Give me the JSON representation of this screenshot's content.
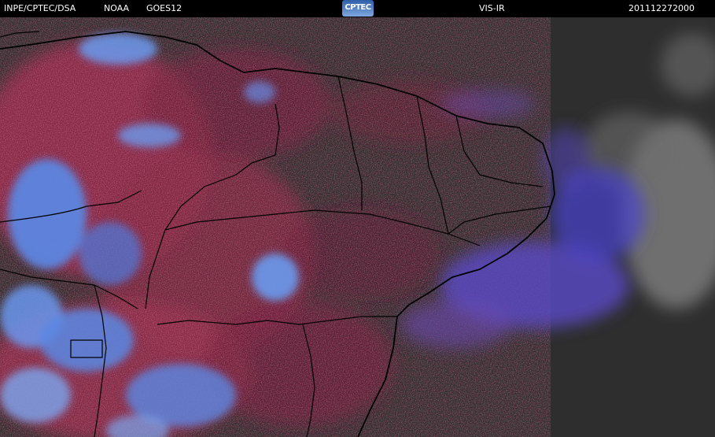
{
  "header": {
    "source": "INPE/CPTEC/DSA",
    "agency": "NOAA",
    "satellite": "GOES12",
    "logo_text": "CPTEC",
    "product": "VIS-IR",
    "timestamp": "201112272000"
  },
  "colors": {
    "background": "#2f2f2f",
    "cloud_blue": "#4a7ee0",
    "cloud_red": "#c0385a",
    "cloud_white": "#d8d8e8",
    "coastline": "#000000"
  }
}
